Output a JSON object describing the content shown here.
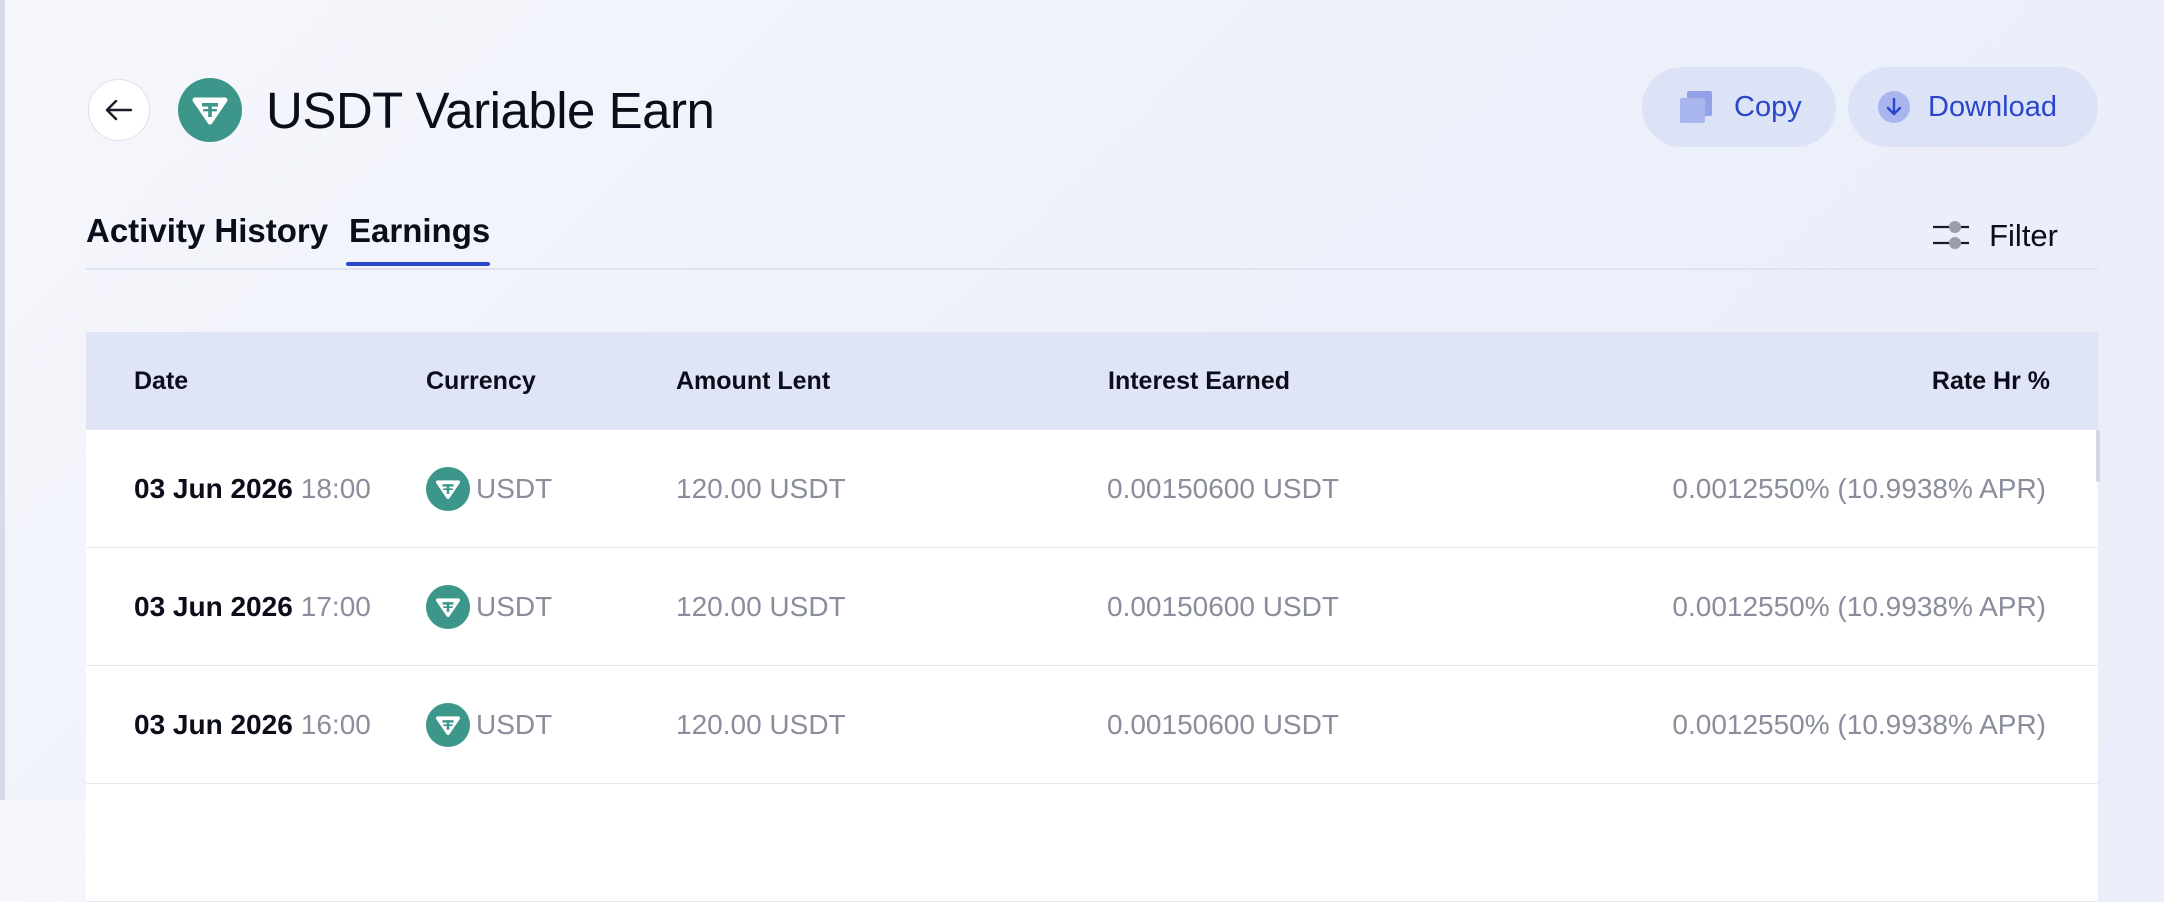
{
  "page": {
    "title": "USDT Variable Earn",
    "coin_icon": "tether-icon",
    "back_icon": "arrow-left-icon"
  },
  "actions": {
    "copy_label": "Copy",
    "download_label": "Download",
    "copy_icon": "copy-icon",
    "download_icon": "download-icon"
  },
  "tabs": [
    {
      "label": "Activity History",
      "active": false
    },
    {
      "label": "Earnings",
      "active": true
    }
  ],
  "filter": {
    "label": "Filter",
    "icon": "sliders-icon"
  },
  "table": {
    "headers": {
      "date": "Date",
      "currency": "Currency",
      "amount": "Amount Lent",
      "interest": "Interest Earned",
      "rate": "Rate Hr %"
    },
    "rows": [
      {
        "date": "03 Jun 2026",
        "time": "18:00",
        "currency": "USDT",
        "amount": "120.00 USDT",
        "interest": "0.00150600 USDT",
        "rate": "0.0012550% (10.9938% APR)"
      },
      {
        "date": "03 Jun 2026",
        "time": "17:00",
        "currency": "USDT",
        "amount": "120.00 USDT",
        "interest": "0.00150600 USDT",
        "rate": "0.0012550% (10.9938% APR)"
      },
      {
        "date": "03 Jun 2026",
        "time": "16:00",
        "currency": "USDT",
        "amount": "120.00 USDT",
        "interest": "0.00150600 USDT",
        "rate": "0.0012550% (10.9938% APR)"
      }
    ]
  },
  "colors": {
    "accent": "#2a46c9",
    "tether": "#3d968a",
    "header_row": "#dfe4f6",
    "pill_bg": "#dde3f6",
    "muted_text": "#8a8e9c"
  }
}
